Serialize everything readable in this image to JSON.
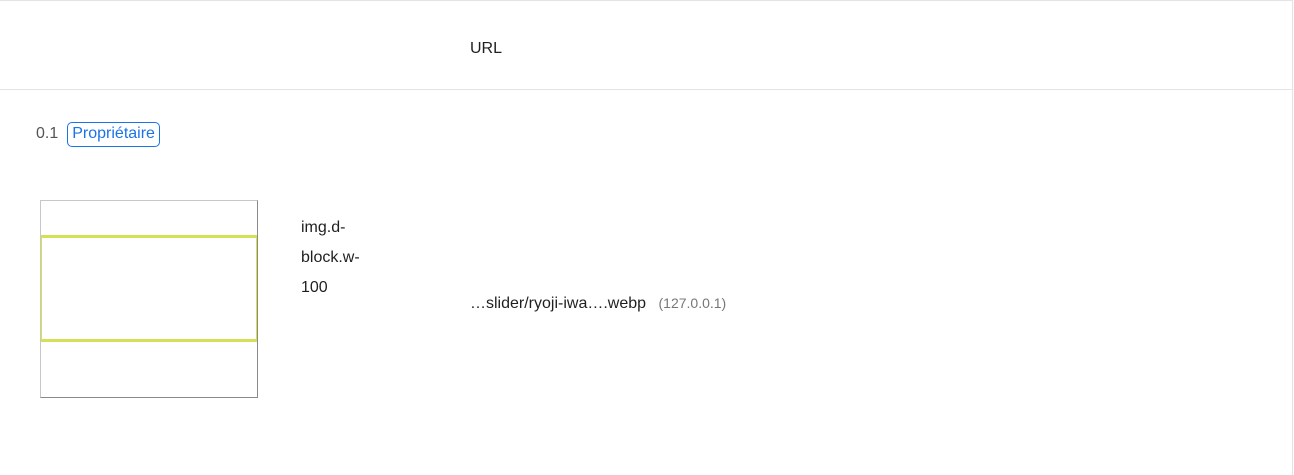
{
  "table": {
    "header": {
      "url_column": "URL"
    },
    "group": {
      "score": "0.1",
      "badge": "Propriétaire"
    },
    "rows": [
      {
        "selector_lines": [
          "img.d-",
          "block.w-",
          "100"
        ],
        "url": "…slider/ryoji-iwa….webp",
        "host": "(127.0.0.1)"
      }
    ]
  },
  "colors": {
    "badge": "#1a73e8",
    "highlight": "#d4e157",
    "border": "#e4e4e4"
  }
}
